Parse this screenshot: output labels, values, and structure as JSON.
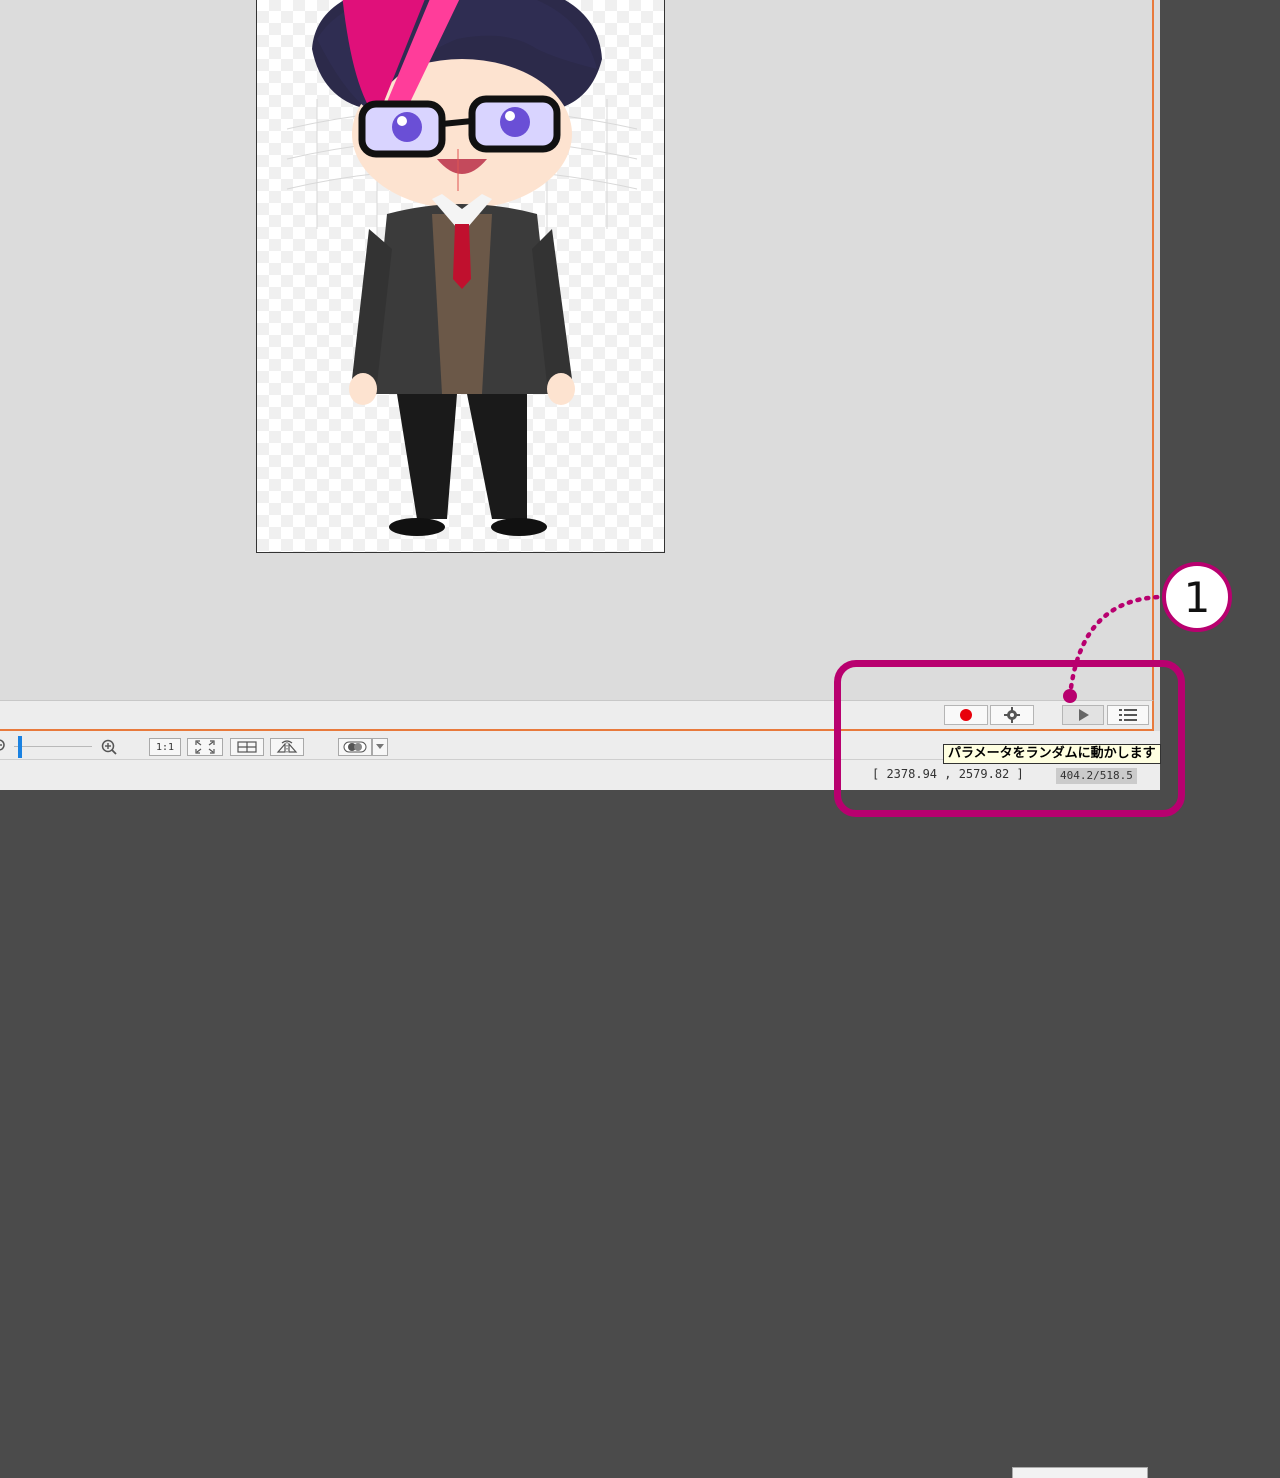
{
  "toolbar": {
    "ratio_label": "1:1"
  },
  "status": {
    "coordinates": "[ 2378.94 , 2579.82 ]",
    "zoom_ratio": "404.2/518.5"
  },
  "tooltip": {
    "text": "パラメータをランダムに動かします"
  },
  "annotation": {
    "callout_number": "1"
  },
  "colors": {
    "accent_orange": "#e87a3c",
    "highlight_magenta": "#b8006f",
    "record_red": "#e8000b",
    "slider_blue": "#1a82e2",
    "tooltip_bg": "#ffffe1"
  }
}
